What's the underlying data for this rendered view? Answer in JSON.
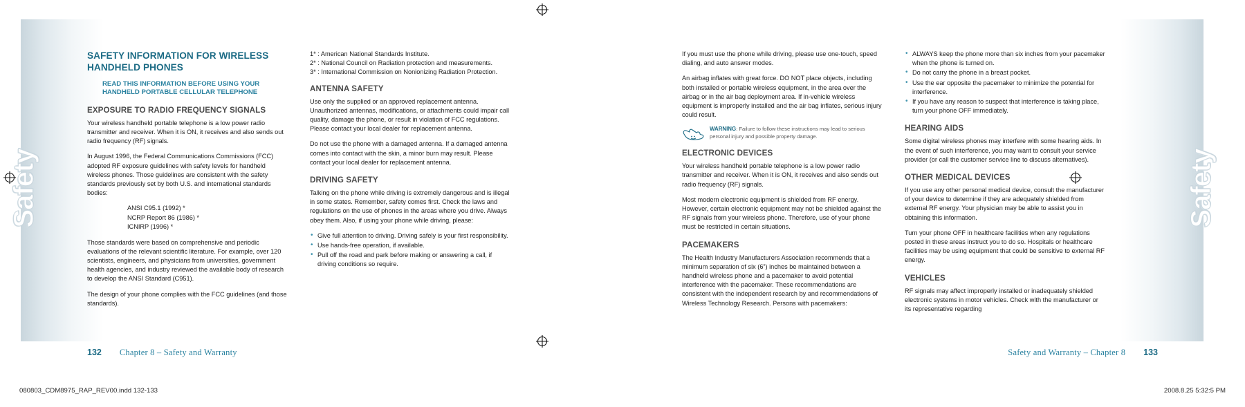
{
  "book": {
    "side_tab_label": "Safety",
    "print_line_left": "080803_CDM8975_RAP_REV00.indd   132-133",
    "print_line_right": "2008.8.25   5:32:5 PM"
  },
  "left_page": {
    "number": "132",
    "footer_text": "Chapter 8 – Safety and Warranty"
  },
  "right_page": {
    "number": "133",
    "footer_text": "Safety and Warranty – Chapter 8"
  },
  "column1": {
    "main_title": "SAFETY INFORMATION FOR WIRELESS HANDHELD PHONES",
    "sub_title": "READ THIS INFORMATION BEFORE USING YOUR HANDHELD PORTABLE CELLULAR TELEPHONE",
    "heading_exposure": "EXPOSURE TO RADIO FREQUENCY SIGNALS",
    "p1": "Your wireless handheld portable telephone is a low power radio transmitter and receiver. When it is ON, it receives and also sends out radio frequency (RF) signals.",
    "p2": "In August 1996, the Federal Communications Commissions (FCC) adopted RF exposure guidelines with safety levels for handheld wireless phones. Those guidelines are consistent with the safety standards previously set by both U.S. and international standards bodies:",
    "standards": [
      "ANSI C95.1 (1992) *",
      "NCRP Report 86 (1986) *",
      "ICNIRP (1996) *"
    ],
    "p3": "Those standards were based on comprehensive and periodic evaluations of the relevant scientific literature. For example, over 120 scientists, engineers, and physicians from universities, government health agencies, and industry reviewed the available body of research to develop the ANSI Standard (C951).",
    "p4": "The design of your phone complies with the FCC guidelines (and those standards)."
  },
  "column2": {
    "footnotes": [
      "1* : American National Standards Institute.",
      "2* : National Council on Radiation protection and measurements.",
      "3* : International Commission on Nonionizing Radiation Protection."
    ],
    "heading_antenna": "ANTENNA SAFETY",
    "p1": "Use only the supplied or an approved replacement antenna. Unauthorized antennas, modifications, or attachments could impair call quality, damage the phone, or result in violation of FCC regulations. Please contact your local dealer for replacement antenna.",
    "p2": "Do not use the phone with a damaged antenna. If a damaged antenna comes into contact with the skin, a minor burn may result. Please contact your local dealer for replacement antenna.",
    "heading_driving": "DRIVING SAFETY",
    "p3": "Talking on the phone while driving is extremely dangerous and is illegal in some states. Remember, safety comes first. Check the laws and regulations on the use of phones in the areas where you drive. Always obey them. Also, if using your phone while driving, please:",
    "bullets": [
      "Give full attention to driving. Driving safely is your first responsibility.",
      "Use hands-free operation, if available.",
      "Pull off the road and park before making or answering a call, if driving conditions so require."
    ]
  },
  "column3": {
    "p1": "If you must use the phone while driving, please use one-touch, speed dialing, and auto answer modes.",
    "p2": "An airbag inflates with great force. DO NOT place objects, including both installed or portable wireless equipment, in the area over the airbag or in the air bag deployment area. If in-vehicle wireless equipment is improperly installed and the air bag inflates, serious injury could result.",
    "warning_label": "WARNING",
    "warning_text": ": Failure to follow these instructions may lead to serious personal injury and possible property damage.",
    "warning_icon": "warning-hand-icon",
    "heading_electronic": "ELECTRONIC DEVICES",
    "p3": "Your wireless handheld portable telephone is a low power radio transmitter and receiver. When it is ON, it receives and also sends out radio frequency (RF) signals.",
    "p4": "Most modern electronic equipment is shielded from RF energy. However, certain electronic equipment may not be shielded against the RF signals from your wireless phone. Therefore, use of your phone must be restricted in certain situations.",
    "heading_pacemakers": "PACEMAKERS",
    "p5": "The Health Industry Manufacturers Association recommends that a minimum separation of six (6”) inches be maintained between a handheld wireless phone and a pacemaker to avoid potential interference with the pacemaker. These recommendations are consistent with the independent research by and recommendations of Wireless Technology Research. Persons with pacemakers:"
  },
  "column4": {
    "bullets": [
      "ALWAYS keep the phone more than six inches from your pacemaker when the phone is turned on.",
      "Do not carry the phone in a breast pocket.",
      "Use the ear opposite the pacemaker to minimize the potential for interference.",
      "If you have any reason to suspect that interference is taking place, turn your phone OFF immediately."
    ],
    "heading_hearing": "HEARING AIDS",
    "p1": "Some digital wireless phones may interfere with some hearing aids. In the event of such interference, you may want to consult your service provider (or call the customer service line to discuss alternatives).",
    "heading_other_medical": "OTHER MEDICAL DEVICES",
    "p2": "If you use any other personal medical device, consult the manufacturer of your device to determine if they are adequately shielded from external RF energy. Your physician may be able to assist you in obtaining this information.",
    "p3": "Turn your phone OFF in healthcare facilities when any regulations posted in these areas instruct you to do so. Hospitals or healthcare facilities may be using equipment that could be sensitive to external RF energy.",
    "heading_vehicles": "VEHICLES",
    "p4": "RF signals may affect improperly installed or inadequately shielded electronic systems in motor vehicles. Check with the manufacturer or its representative regarding"
  },
  "colors": {
    "title_teal": "#1c6b85",
    "subtitle_teal": "#2a82a0",
    "section_gray": "#4c4c4c",
    "bullet_blue": "#3f93ad"
  }
}
